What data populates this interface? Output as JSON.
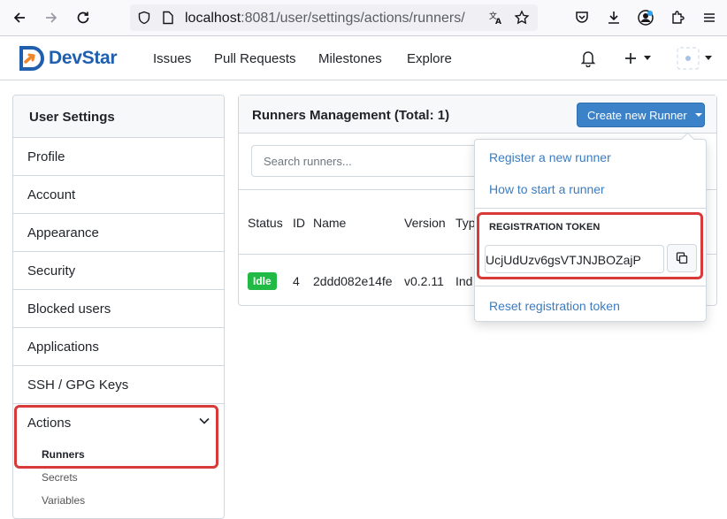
{
  "browser": {
    "url_host": "localhost",
    "url_rest": ":8081/user/settings/actions/runners/"
  },
  "header": {
    "brand": "DevStar",
    "nav": [
      "Issues",
      "Pull Requests",
      "Milestones",
      "Explore"
    ],
    "plus_label": "+"
  },
  "sidebar": {
    "title": "User Settings",
    "items": [
      "Profile",
      "Account",
      "Appearance",
      "Security",
      "Blocked users",
      "Applications",
      "SSH / GPG Keys"
    ],
    "group_label": "Actions",
    "sub_items": [
      "Runners",
      "Secrets",
      "Variables"
    ],
    "active_sub": "Runners"
  },
  "panel": {
    "title": "Runners Management (Total: 1)",
    "create_button": "Create new Runner",
    "search_placeholder": "Search runners...",
    "columns": [
      "Status",
      "ID",
      "Name",
      "Version",
      "Typ"
    ],
    "row": {
      "status": "Idle",
      "id": "4",
      "name": "2ddd082e14fe",
      "version": "v0.2.11",
      "type": "Ind"
    }
  },
  "dropdown": {
    "register_link": "Register a new runner",
    "howto_link": "How to start a runner",
    "token_label": "REGISTRATION TOKEN",
    "token_value": "UcjUdUzv6gsVTJNJBOZajP",
    "reset_link": "Reset registration token"
  },
  "colors": {
    "accent": "#3b82c8",
    "link": "#3b7cc0",
    "status_idle": "#21ba45",
    "highlight": "#d83a3a"
  }
}
